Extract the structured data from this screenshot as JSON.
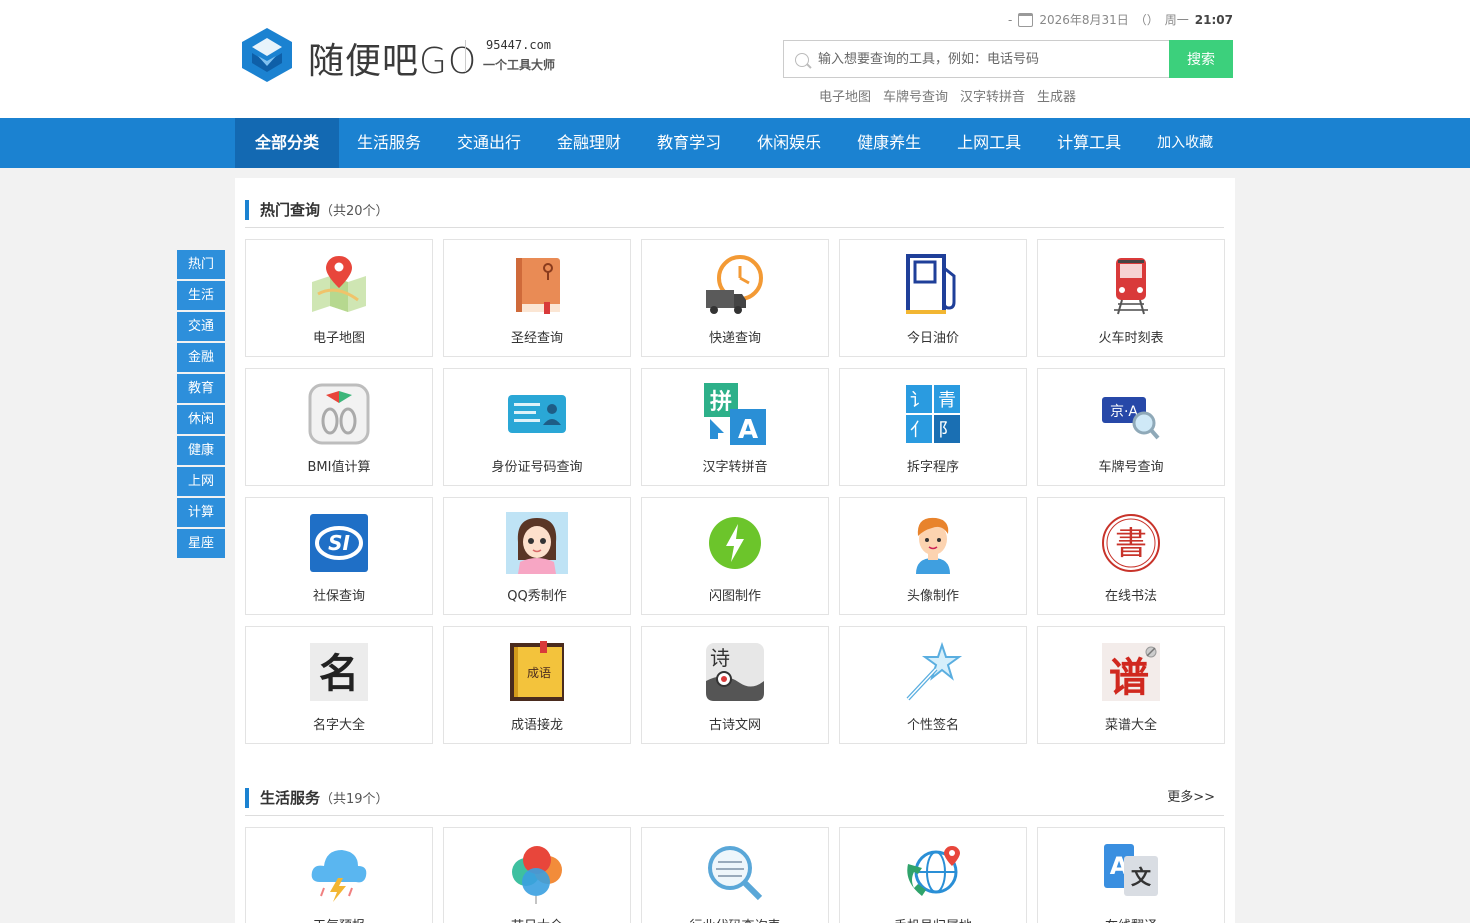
{
  "header": {
    "brand": "随便吧GO",
    "domain": "95447.com",
    "slogan": "一个工具大师",
    "topbar": {
      "dash": "-",
      "date": "2026年8月31日",
      "paren": "（）",
      "weekday": "周一",
      "time": "21:07"
    },
    "search": {
      "placeholder": "输入想要查询的工具，例如：电话号码",
      "button": "搜索"
    },
    "hot_words": [
      "电子地图",
      "车牌号查询",
      "汉字转拼音",
      "生成器"
    ]
  },
  "nav": {
    "items": [
      "全部分类",
      "生活服务",
      "交通出行",
      "金融理财",
      "教育学习",
      "休闲娱乐",
      "健康养生",
      "上网工具",
      "计算工具",
      "加入收藏"
    ],
    "active_color": "#1369b2",
    "bar_color": "#1b82d1"
  },
  "side_nav": [
    "热门",
    "生活",
    "交通",
    "金融",
    "教育",
    "休闲",
    "健康",
    "上网",
    "计算",
    "星座"
  ],
  "sections": {
    "hot": {
      "title": "热门查询",
      "count": "（共20个）",
      "items": [
        {
          "label": "电子地图",
          "icon": "map-icon"
        },
        {
          "label": "圣经查询",
          "icon": "bible-icon"
        },
        {
          "label": "快递查询",
          "icon": "delivery-icon"
        },
        {
          "label": "今日油价",
          "icon": "fuel-icon"
        },
        {
          "label": "火车时刻表",
          "icon": "train-icon"
        },
        {
          "label": "BMI值计算",
          "icon": "scale-icon"
        },
        {
          "label": "身份证号码查询",
          "icon": "id-card-icon"
        },
        {
          "label": "汉字转拼音",
          "icon": "pinyin-icon"
        },
        {
          "label": "拆字程序",
          "icon": "split-char-icon"
        },
        {
          "label": "车牌号查询",
          "icon": "license-plate-icon"
        },
        {
          "label": "社保查询",
          "icon": "social-security-icon"
        },
        {
          "label": "QQ秀制作",
          "icon": "qq-show-icon"
        },
        {
          "label": "闪图制作",
          "icon": "flash-icon"
        },
        {
          "label": "头像制作",
          "icon": "avatar-icon"
        },
        {
          "label": "在线书法",
          "icon": "calligraphy-icon"
        },
        {
          "label": "名字大全",
          "icon": "name-icon"
        },
        {
          "label": "成语接龙",
          "icon": "idiom-book-icon"
        },
        {
          "label": "古诗文网",
          "icon": "poem-icon"
        },
        {
          "label": "个性签名",
          "icon": "star-wand-icon"
        },
        {
          "label": "菜谱大全",
          "icon": "recipe-icon"
        }
      ]
    },
    "life": {
      "title": "生活服务",
      "count": "（共19个）",
      "more": "更多>>",
      "items": [
        {
          "label": "天气预报",
          "icon": "weather-icon"
        },
        {
          "label": "节日大全",
          "icon": "balloon-icon"
        },
        {
          "label": "行业代码查询表",
          "icon": "code-search-icon"
        },
        {
          "label": "手机号归属地",
          "icon": "phone-globe-icon"
        },
        {
          "label": "在线翻译",
          "icon": "translate-icon"
        }
      ]
    }
  },
  "icon_glyphs": {
    "pinyin": "拼",
    "pinyin_a": "A",
    "split_1": "讠",
    "split_2": "青",
    "split_3": "亻",
    "split_4": "阝",
    "plate": "京·A",
    "social": "SI",
    "calligraphy": "書",
    "name": "名",
    "idiom": "成语",
    "poem": "诗",
    "recipe": "谱",
    "translate_a": "A",
    "translate_zh": "文"
  }
}
